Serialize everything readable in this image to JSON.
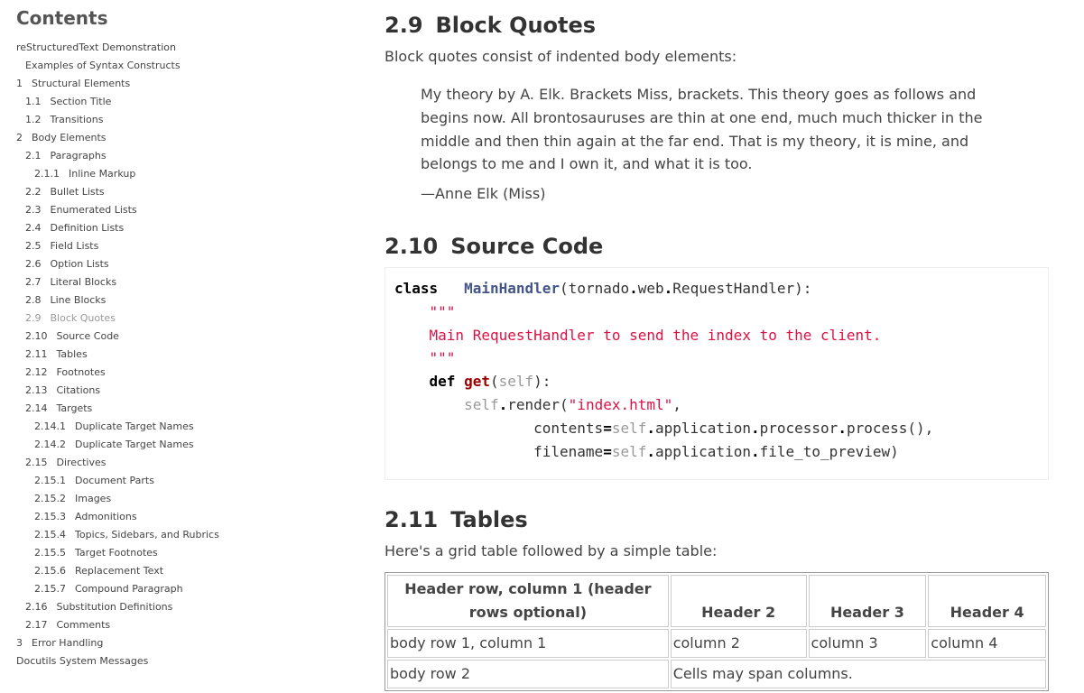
{
  "sidebar": {
    "title": "Contents",
    "toc": [
      {
        "num": "",
        "label": "reStructuredText Demonstration",
        "level": 0
      },
      {
        "num": "",
        "label": "Examples of Syntax Constructs",
        "level": 1
      },
      {
        "num": "1",
        "label": "Structural Elements",
        "level": 0
      },
      {
        "num": "1.1",
        "label": "Section Title",
        "level": 1
      },
      {
        "num": "1.2",
        "label": "Transitions",
        "level": 1
      },
      {
        "num": "2",
        "label": "Body Elements",
        "level": 0
      },
      {
        "num": "2.1",
        "label": "Paragraphs",
        "level": 1
      },
      {
        "num": "2.1.1",
        "label": "Inline Markup",
        "level": 2
      },
      {
        "num": "2.2",
        "label": "Bullet Lists",
        "level": 1
      },
      {
        "num": "2.3",
        "label": "Enumerated Lists",
        "level": 1
      },
      {
        "num": "2.4",
        "label": "Definition Lists",
        "level": 1
      },
      {
        "num": "2.5",
        "label": "Field Lists",
        "level": 1
      },
      {
        "num": "2.6",
        "label": "Option Lists",
        "level": 1
      },
      {
        "num": "2.7",
        "label": "Literal Blocks",
        "level": 1
      },
      {
        "num": "2.8",
        "label": "Line Blocks",
        "level": 1
      },
      {
        "num": "2.9",
        "label": "Block Quotes",
        "level": 1,
        "current": true
      },
      {
        "num": "2.10",
        "label": "Source Code",
        "level": 1
      },
      {
        "num": "2.11",
        "label": "Tables",
        "level": 1
      },
      {
        "num": "2.12",
        "label": "Footnotes",
        "level": 1
      },
      {
        "num": "2.13",
        "label": "Citations",
        "level": 1
      },
      {
        "num": "2.14",
        "label": "Targets",
        "level": 1
      },
      {
        "num": "2.14.1",
        "label": "Duplicate Target Names",
        "level": 2
      },
      {
        "num": "2.14.2",
        "label": "Duplicate Target Names",
        "level": 2
      },
      {
        "num": "2.15",
        "label": "Directives",
        "level": 1
      },
      {
        "num": "2.15.1",
        "label": "Document Parts",
        "level": 2
      },
      {
        "num": "2.15.2",
        "label": "Images",
        "level": 2
      },
      {
        "num": "2.15.3",
        "label": "Admonitions",
        "level": 2
      },
      {
        "num": "2.15.4",
        "label": "Topics, Sidebars, and Rubrics",
        "level": 2
      },
      {
        "num": "2.15.5",
        "label": "Target Footnotes",
        "level": 2
      },
      {
        "num": "2.15.6",
        "label": "Replacement Text",
        "level": 2
      },
      {
        "num": "2.15.7",
        "label": "Compound Paragraph",
        "level": 2
      },
      {
        "num": "2.16",
        "label": "Substitution Definitions",
        "level": 1
      },
      {
        "num": "2.17",
        "label": "Comments",
        "level": 1
      },
      {
        "num": "3",
        "label": "Error Handling",
        "level": 0
      },
      {
        "num": "",
        "label": "Docutils System Messages",
        "level": 0
      }
    ]
  },
  "main": {
    "block_quotes": {
      "num": "2.9",
      "title": "Block Quotes",
      "intro": "Block quotes consist of indented body elements:",
      "quote": "My theory by A. Elk. Brackets Miss, brackets. This theory goes as follows and begins now. All brontosauruses are thin at one end, much much thicker in the middle and then thin again at the far end. That is my theory, it is mine, and belongs to me and I own it, and what it is too.",
      "attribution": "—Anne Elk (Miss)"
    },
    "source_code": {
      "num": "2.10",
      "title": "Source Code",
      "lines": [
        [
          [
            "kw",
            "class"
          ],
          [
            "",
            "   "
          ],
          [
            "cls",
            "MainHandler"
          ],
          [
            "",
            "(tornado"
          ],
          [
            "op",
            "."
          ],
          [
            "",
            "web"
          ],
          [
            "op",
            "."
          ],
          [
            "",
            "RequestHandler):"
          ]
        ],
        [
          [
            "",
            "    "
          ],
          [
            "str",
            "\"\"\""
          ]
        ],
        [
          [
            "",
            "    "
          ],
          [
            "str",
            "Main RequestHandler to send the index to the client."
          ]
        ],
        [
          [
            "",
            "    "
          ],
          [
            "str",
            "\"\"\""
          ]
        ],
        [
          [
            "",
            "    "
          ],
          [
            "kw",
            "def"
          ],
          [
            "",
            " "
          ],
          [
            "fn",
            "get"
          ],
          [
            "",
            "("
          ],
          [
            "slf",
            "self"
          ],
          [
            "",
            "):"
          ]
        ],
        [
          [
            "",
            "        "
          ],
          [
            "slf",
            "self"
          ],
          [
            "op",
            "."
          ],
          [
            "",
            "render("
          ],
          [
            "str",
            "\"index.html\""
          ],
          [
            "",
            ","
          ]
        ],
        [
          [
            "",
            "                "
          ],
          [
            "",
            "contents"
          ],
          [
            "op",
            "="
          ],
          [
            "slf",
            "self"
          ],
          [
            "op",
            "."
          ],
          [
            "",
            "application"
          ],
          [
            "op",
            "."
          ],
          [
            "",
            "processor"
          ],
          [
            "op",
            "."
          ],
          [
            "",
            "process(),"
          ]
        ],
        [
          [
            "",
            "                "
          ],
          [
            "",
            "filename"
          ],
          [
            "op",
            "="
          ],
          [
            "slf",
            "self"
          ],
          [
            "op",
            "."
          ],
          [
            "",
            "application"
          ],
          [
            "op",
            "."
          ],
          [
            "",
            "file_to_preview)"
          ]
        ]
      ]
    },
    "tables": {
      "num": "2.11",
      "title": "Tables",
      "intro": "Here's a grid table followed by a simple table:",
      "headers": [
        "Header row, column 1 (header rows optional)",
        "Header 2",
        "Header 3",
        "Header 4"
      ],
      "row1": [
        "body row 1, column 1",
        "column 2",
        "column 3",
        "column 4"
      ],
      "row2": [
        "body row 2",
        "Cells may span columns."
      ]
    }
  }
}
